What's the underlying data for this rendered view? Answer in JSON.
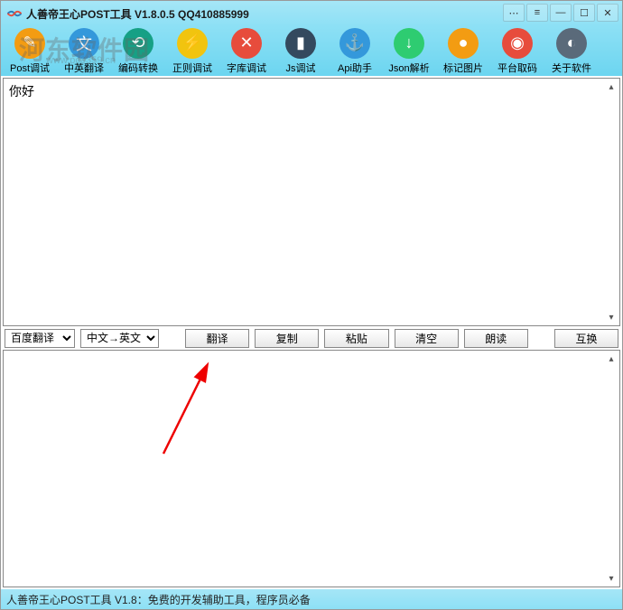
{
  "window": {
    "title": "人善帝王心POST工具 V1.8.0.5 QQ410885999"
  },
  "watermark": {
    "main": "河东软件园",
    "sub": "www.pc0359.cn"
  },
  "toolbar": [
    {
      "label": "Post调试",
      "icon": "post-icon",
      "color": "ic-orange",
      "glyph": "✎"
    },
    {
      "label": "中英翻译",
      "icon": "translate-icon",
      "color": "ic-blue",
      "glyph": "文"
    },
    {
      "label": "编码转换",
      "icon": "encode-icon",
      "color": "ic-teal",
      "glyph": "⟲"
    },
    {
      "label": "正则调试",
      "icon": "regex-icon",
      "color": "ic-yellow",
      "glyph": "⚡"
    },
    {
      "label": "字库调试",
      "icon": "font-icon",
      "color": "ic-red",
      "glyph": "✕"
    },
    {
      "label": "Js调试",
      "icon": "js-icon",
      "color": "ic-darkblue",
      "glyph": "▮"
    },
    {
      "label": "Api助手",
      "icon": "api-icon",
      "color": "ic-blue",
      "glyph": "⚓"
    },
    {
      "label": "Json解析",
      "icon": "json-icon",
      "color": "ic-green",
      "glyph": "↓"
    },
    {
      "label": "标记图片",
      "icon": "mark-icon",
      "color": "ic-orange",
      "glyph": "●"
    },
    {
      "label": "平台取码",
      "icon": "code-icon",
      "color": "ic-red",
      "glyph": "◉"
    },
    {
      "label": "关于软件",
      "icon": "about-icon",
      "color": "ic-gray",
      "glyph": "◐"
    }
  ],
  "input": {
    "text": "你好"
  },
  "output": {
    "text": ""
  },
  "controls": {
    "engine": "百度翻译",
    "direction": "中文→英文",
    "buttons": {
      "translate": "翻译",
      "copy": "复制",
      "paste": "粘贴",
      "clear": "清空",
      "speak": "朗读",
      "swap": "互换"
    }
  },
  "statusbar": {
    "text": "人善帝王心POST工具 V1.8：免费的开发辅助工具，程序员必备"
  }
}
